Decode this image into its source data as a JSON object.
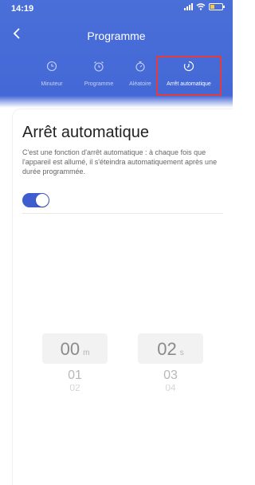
{
  "status_bar": {
    "time": "14:19"
  },
  "header": {
    "title": "Programme"
  },
  "tabs": [
    {
      "label": "Minuteur",
      "icon": "clock-icon"
    },
    {
      "label": "Programme",
      "icon": "alarm-clock-icon"
    },
    {
      "label": "Aléatoire",
      "icon": "stopwatch-icon"
    },
    {
      "label": "Arrêt automatique",
      "icon": "timer-icon",
      "active": true
    }
  ],
  "card": {
    "title": "Arrêt automatique",
    "description": "C'est une fonction d'arrêt automatique : à chaque fois que l'appareil est allumé, il s'éteindra automatiquement après une durée programmée.",
    "toggle_on": true
  },
  "picker_minutes": {
    "value": "00",
    "unit": "m",
    "next": "01",
    "next2": "02"
  },
  "picker_seconds": {
    "value": "02",
    "unit": "s",
    "next": "03",
    "next2": "04"
  },
  "colors": {
    "accent": "#4468d6",
    "highlight": "#e43b3b",
    "toggle": "#3e5ed0"
  }
}
